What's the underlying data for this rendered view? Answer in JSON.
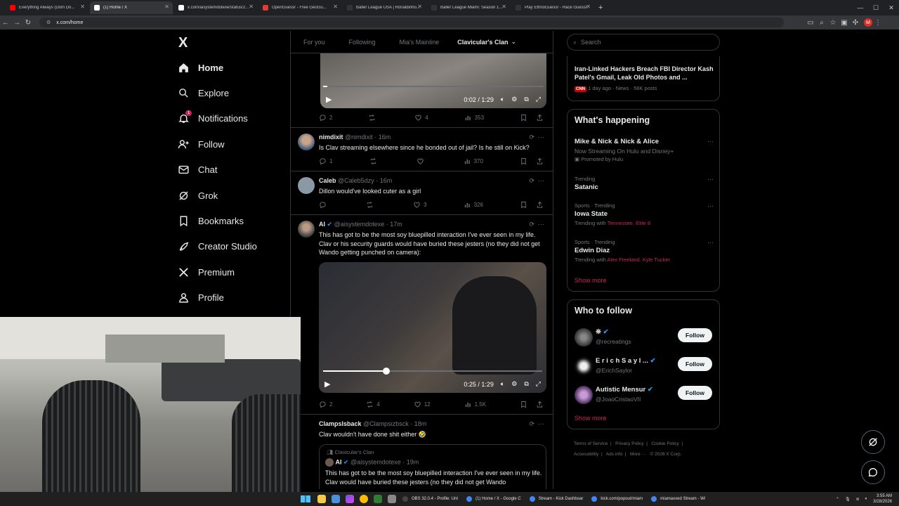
{
  "browser": {
    "tabs": [
      {
        "label": "Everything Always (Dom Do...",
        "color": "#ff0000",
        "active": false
      },
      {
        "label": "(1) Home / X",
        "color": "#ffffff",
        "active": true
      },
      {
        "label": "x.com/aisystemdotexe/status/2...",
        "color": "#ffffff",
        "active": false
      },
      {
        "label": "OpenGuessr - Free GeoGu...",
        "color": "#e53935",
        "active": false
      },
      {
        "label": "Baller League USA | Ronaldinho...",
        "color": "#333333",
        "active": false
      },
      {
        "label": "Baller League Miami: Season 1...",
        "color": "#333333",
        "active": false
      },
      {
        "label": "Play EthnoGuessr - Race Guessr...",
        "color": "#333333",
        "active": false
      }
    ],
    "url": "x.com/home",
    "new_tab": "+",
    "minimize": "—",
    "maximize": "☐",
    "close": "✕",
    "profile_initial": "M"
  },
  "sidebar": {
    "logo": "X",
    "items": [
      {
        "label": "Home",
        "icon": "home-icon"
      },
      {
        "label": "Explore",
        "icon": "search-icon"
      },
      {
        "label": "Notifications",
        "icon": "bell-icon",
        "badge": "1"
      },
      {
        "label": "Follow",
        "icon": "person-add-icon"
      },
      {
        "label": "Chat",
        "icon": "mail-icon"
      },
      {
        "label": "Grok",
        "icon": "grok-icon"
      },
      {
        "label": "Bookmarks",
        "icon": "bookmark-icon"
      },
      {
        "label": "Creator Studio",
        "icon": "rocket-icon"
      },
      {
        "label": "Premium",
        "icon": "x-icon"
      },
      {
        "label": "Profile",
        "icon": "person-icon"
      }
    ]
  },
  "timeline_tabs": [
    "For you",
    "Following",
    "Mia's Mainline",
    "Clavicular's Clan"
  ],
  "video1": {
    "time": "0:02 / 1:29",
    "progress": 0.02
  },
  "post0_actions": {
    "replies": "2",
    "reposts": "",
    "likes": "4",
    "views": "353"
  },
  "posts": [
    {
      "name": "nimdixit",
      "handle": "@nimdixit",
      "time": "· 16m",
      "text": "Is Clav streaming elsewhere since he bonded out of jail? Is he still on Kick?",
      "replies": "1",
      "reposts": "",
      "likes": "",
      "views": "370"
    },
    {
      "name": "Caleb",
      "handle": "@Caleb5dzy",
      "time": "· 16m",
      "text": "Dillon would've looked cuter as a girl",
      "replies": "",
      "reposts": "",
      "likes": "3",
      "views": "326"
    },
    {
      "name": "AI",
      "handle": "@aisystemdotexe",
      "time": "· 17m",
      "text": "This has got to be the most soy bluepilled interaction I've ever seen in my life. Clav or his security guards would have buried these jesters (no they did not get Wando getting punched on camera):",
      "replies": "2",
      "reposts": "4",
      "likes": "12",
      "views": "1.5K"
    },
    {
      "name": "Clampslsback",
      "handle": "@Clampsizbsck",
      "time": "· 18m",
      "text": "Clav wouldn't have done shit either 🤣"
    }
  ],
  "video2": {
    "time": "0:25 / 1:29",
    "progress": 0.29
  },
  "quote": {
    "community": "Clavicular's Clan",
    "name": "AI",
    "handle": "@aisystemdotexe",
    "time": "· 19m",
    "text": "This has got to be the most soy bluepilled interaction I've ever seen in my life. Clav would have buried these jesters (no they did not get Wando"
  },
  "right": {
    "search_placeholder": "Search",
    "news": {
      "headline": "Iran-Linked Hackers Breach FBI Director Kash Patel's Gmail, Leak Old Photos and ...",
      "source": "CNN",
      "meta": "1 day ago · News · 56K posts"
    },
    "whats_happening": {
      "title": "What's happening",
      "items": [
        {
          "meta": "",
          "name": "Mike & Nick & Nick & Alice",
          "sub": "Now Streaming On Hulu and Disney+",
          "promo": "Promoted by Hulu",
          "with": "",
          "with_links": []
        },
        {
          "meta": "Trending",
          "name": "Satanic",
          "sub": "",
          "promo": "",
          "with": "",
          "with_links": []
        },
        {
          "meta": "Sports · Trending",
          "name": "Iowa State",
          "sub": "",
          "promo": "",
          "with": "Trending with",
          "with_links": [
            "Tennessee",
            "Elite 8"
          ]
        },
        {
          "meta": "Sports · Trending",
          "name": "Edwin Diaz",
          "sub": "",
          "promo": "",
          "with": "Trending with",
          "with_links": [
            "Alex Freeland",
            "Kyle Tucker"
          ]
        }
      ],
      "show_more": "Show more"
    },
    "who_to_follow": {
      "title": "Who to follow",
      "items": [
        {
          "name": "❊",
          "handle": "@recreatings",
          "button": "Follow"
        },
        {
          "name": "E r i c h  S a y l ...",
          "handle": "@ErichSaylor",
          "button": "Follow"
        },
        {
          "name": "Autistic Mensur",
          "handle": "@JoaoCristaoVII",
          "button": "Follow"
        }
      ],
      "show_more": "Show more"
    },
    "footer": [
      "Terms of Service",
      "Privacy Policy",
      "Cookie Policy",
      "Accessibility",
      "Ads info",
      "More ···",
      "© 2026 X Corp."
    ]
  },
  "taskbar": {
    "apps": [
      {
        "label": "OBS 32.0.4 - Profile: Unt",
        "color": "#444444"
      },
      {
        "label": "(1) Home / X - Google C",
        "color": "#4285f4"
      },
      {
        "label": "Stream - Kick Dashboar",
        "color": "#4285f4"
      },
      {
        "label": "kick.com/popout/miam",
        "color": "#4285f4"
      },
      {
        "label": "miamaxxed Stream - Wi",
        "color": "#4285f4"
      }
    ],
    "time": "3:55 AM",
    "date": "3/28/2026"
  }
}
